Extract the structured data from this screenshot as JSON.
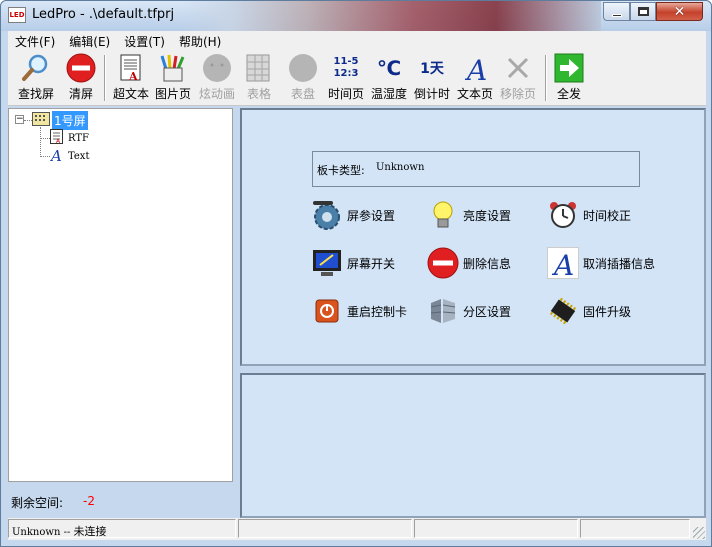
{
  "window": {
    "title": "LedPro - .\\default.tfprj",
    "app_icon_text": "LED"
  },
  "menu": [
    {
      "label": "文件(F)"
    },
    {
      "label": "编辑(E)"
    },
    {
      "label": "设置(T)"
    },
    {
      "label": "帮助(H)"
    }
  ],
  "toolbar": {
    "find_screen": "查找屏",
    "clear_screen": "清屏",
    "super_text": "超文本",
    "picture_page": "图片页",
    "animation": "炫动画",
    "table": "表格",
    "dial": "表盘",
    "time_page": "时间页",
    "time_icon_line1": "11-5",
    "time_icon_line2": "12:3",
    "temp_humidity": "温湿度",
    "temp_icon": "℃",
    "countdown": "倒计时",
    "countdown_icon": "1天",
    "text_page": "文本页",
    "remove_page": "移除页",
    "send_all": "全发"
  },
  "tree": {
    "root_label": "1号屏",
    "children": [
      {
        "label": "RTF"
      },
      {
        "label": "Text"
      }
    ]
  },
  "space": {
    "label": "剩余空间:",
    "value": "-2"
  },
  "board": {
    "label": "板卡类型:",
    "value": "Unknown"
  },
  "actions": {
    "screen_params": "屏参设置",
    "brightness": "亮度设置",
    "time_calibration": "时间校正",
    "screen_switch": "屏幕开关",
    "delete_info": "删除信息",
    "cancel_insert": "取消插播信息",
    "restart_controller": "重启控制卡",
    "partition": "分区设置",
    "firmware_upgrade": "固件升级"
  },
  "status": {
    "device": "Unknown",
    "separator": " -- ",
    "connection": "未连接"
  },
  "colors": {
    "panel_bg": "#d3e4f7",
    "frame_bg": "#c5d8ee",
    "selection": "#3399ff",
    "negative_value": "#ff0000"
  }
}
